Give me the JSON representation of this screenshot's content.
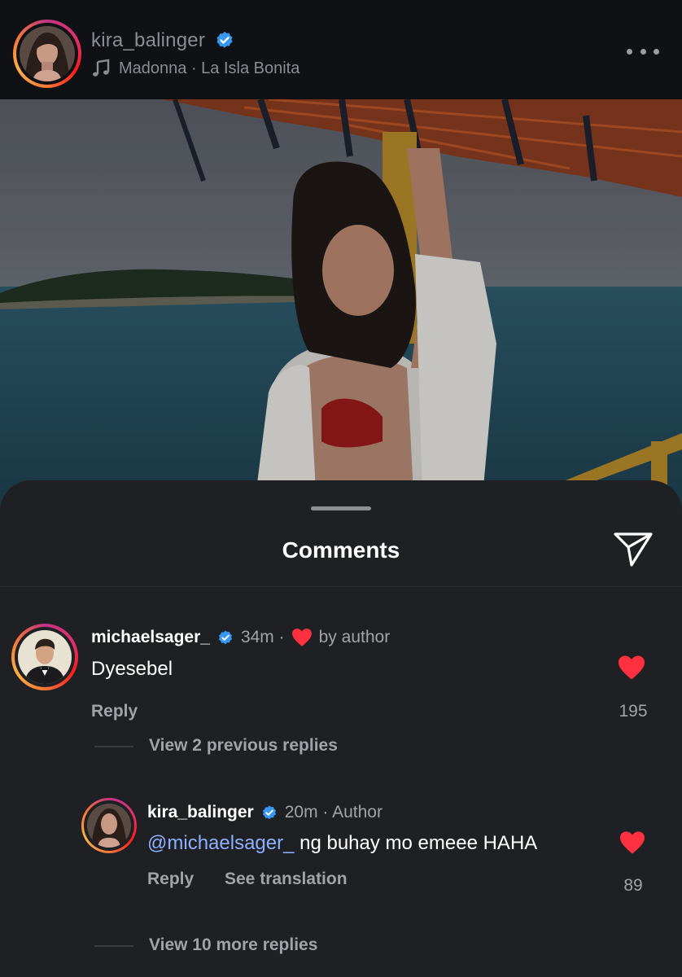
{
  "header": {
    "username": "kira_balinger",
    "music": "Madonna · La Isla Bonita"
  },
  "sheet": {
    "title": "Comments"
  },
  "comments": [
    {
      "username": "michaelsager_",
      "time": "34m ·",
      "liked_by": "by author",
      "text": "Dyesebel",
      "reply_label": "Reply",
      "likes": "195",
      "view_replies": "View 2 previous replies"
    }
  ],
  "reply": {
    "username": "kira_balinger",
    "meta": "20m · Author",
    "mention": "@michaelsager_",
    "text": " ng buhay mo emeee HAHA",
    "reply_label": "Reply",
    "translate_label": "See translation",
    "likes": "89",
    "view_more": "View 10 more replies"
  },
  "colors": {
    "verified": "#3897f0",
    "heart": "#ff3040",
    "mention": "#8fb0ff"
  },
  "icons": [
    "verified-badge-icon",
    "music-note-icon",
    "more-options-icon",
    "send-icon",
    "heart-icon"
  ]
}
